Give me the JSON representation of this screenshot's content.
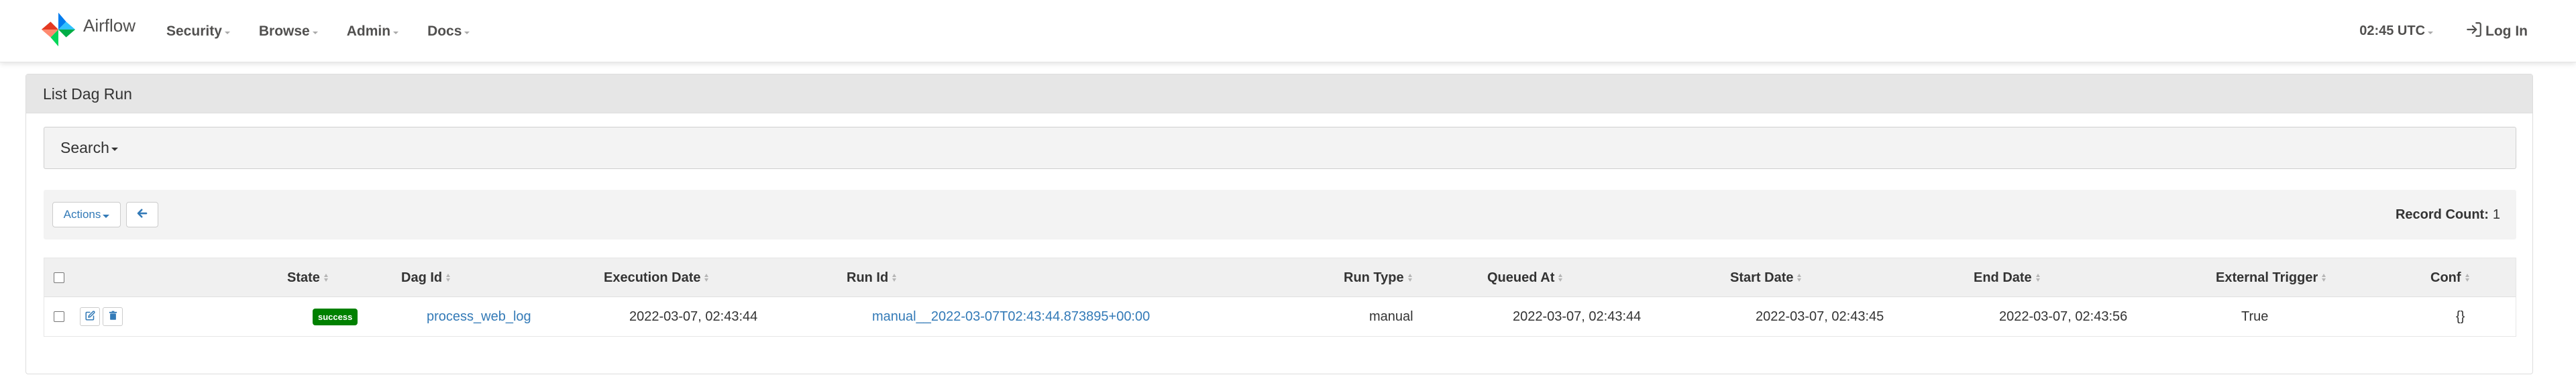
{
  "brand": {
    "name": "Airflow"
  },
  "nav": {
    "items": [
      {
        "label": "Security"
      },
      {
        "label": "Browse"
      },
      {
        "label": "Admin"
      },
      {
        "label": "Docs"
      }
    ],
    "clock": "02:45 UTC",
    "login": "Log In"
  },
  "panel": {
    "title": "List Dag Run",
    "search_label": "Search",
    "actions_label": "Actions",
    "record_count_label": "Record Count:",
    "record_count": "1"
  },
  "table": {
    "columns": [
      {
        "label": "State"
      },
      {
        "label": "Dag Id"
      },
      {
        "label": "Execution Date"
      },
      {
        "label": "Run Id"
      },
      {
        "label": "Run Type"
      },
      {
        "label": "Queued At"
      },
      {
        "label": "Start Date"
      },
      {
        "label": "End Date"
      },
      {
        "label": "External Trigger"
      },
      {
        "label": "Conf"
      }
    ],
    "rows": [
      {
        "state": "success",
        "dag_id": "process_web_log",
        "execution_date": "2022-03-07, 02:43:44",
        "run_id": "manual__2022-03-07T02:43:44.873895+00:00",
        "run_type": "manual",
        "queued_at": "2022-03-07, 02:43:44",
        "start_date": "2022-03-07, 02:43:45",
        "end_date": "2022-03-07, 02:43:56",
        "external_trigger": "True",
        "conf": "{}"
      }
    ]
  },
  "colors": {
    "success": "#008000",
    "link": "#337ab7",
    "header_bg": "#e6e6e6"
  },
  "icons": {
    "logo": "airflow-pinwheel-logo",
    "login": "sign-in-icon",
    "back": "arrow-left-icon",
    "edit": "edit-icon",
    "delete": "trash-icon"
  }
}
